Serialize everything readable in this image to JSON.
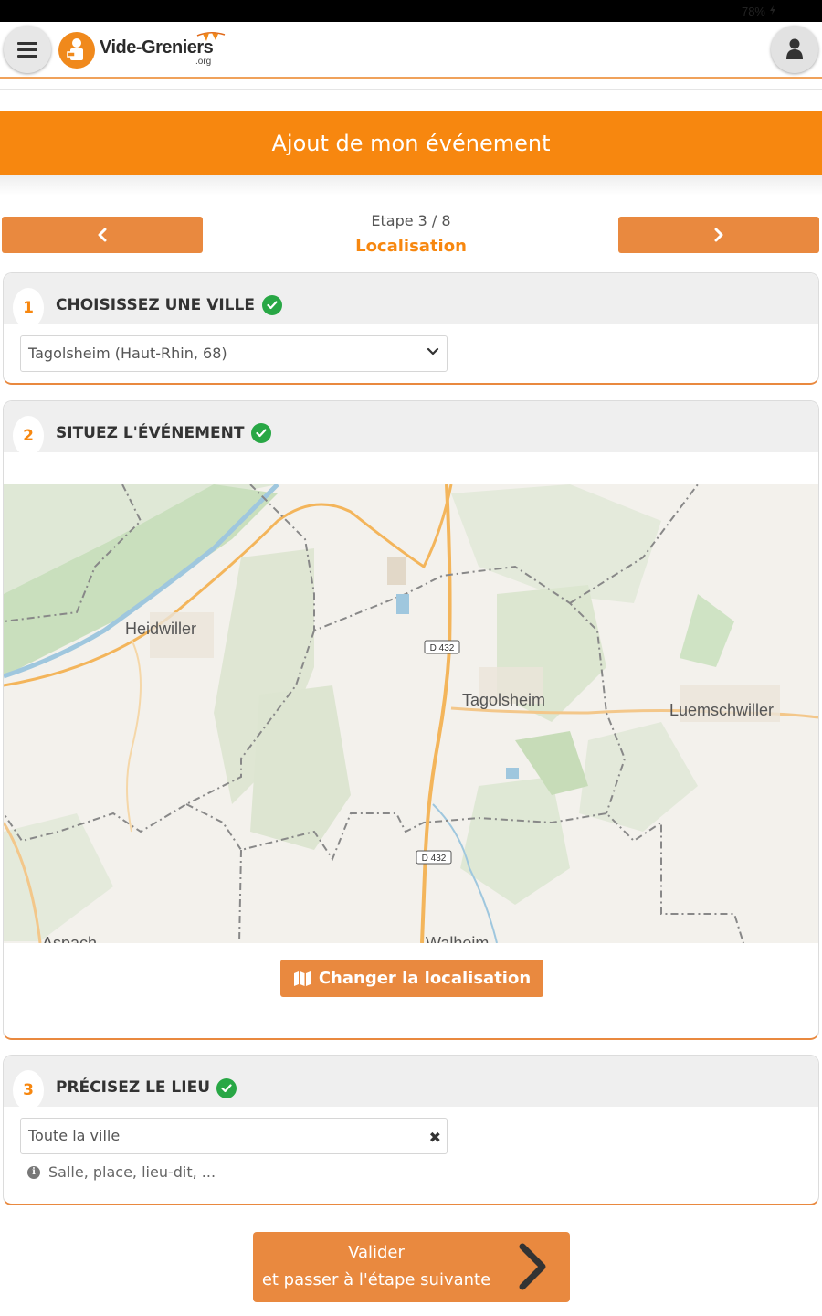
{
  "status_bar": {
    "battery": "78%"
  },
  "header": {
    "brand_name": "Vide-Greniers",
    "brand_tld": ".org",
    "menu_icon": "hamburger-icon",
    "user_icon": "user-icon"
  },
  "banner": {
    "title": "Ajout de mon événement"
  },
  "stepper": {
    "step_counter": "Etape 3 / 8",
    "step_name": "Localisation",
    "prev_icon": "chevron-left-icon",
    "next_icon": "chevron-right-icon"
  },
  "section1": {
    "number": "1",
    "title": "CHOISISSEZ UNE VILLE",
    "city_value": "Tagolsheim (Haut-Rhin, 68)"
  },
  "section2": {
    "number": "2",
    "title": "SITUEZ L'ÉVÉNEMENT",
    "map": {
      "labels": {
        "heidwiller": "Heidwiller",
        "tagolsheim": "Tagolsheim",
        "luemschwiller": "Luemschwiller",
        "aspach": "Aspach",
        "walheim": "Walheim",
        "road_north": "D 432",
        "road_south": "D 432"
      }
    },
    "change_button": "Changer la localisation",
    "change_icon": "map-icon"
  },
  "section3": {
    "number": "3",
    "title": "PRÉCISEZ LE LIEU",
    "place_value": "Toute la ville",
    "hint": "Salle, place, lieu-dit, ..."
  },
  "submit": {
    "line1": "Valider",
    "line2": "et passer à l'étape suivante"
  },
  "colors": {
    "accent": "#f7870f",
    "button": "#e9893f",
    "success": "#28a745"
  }
}
